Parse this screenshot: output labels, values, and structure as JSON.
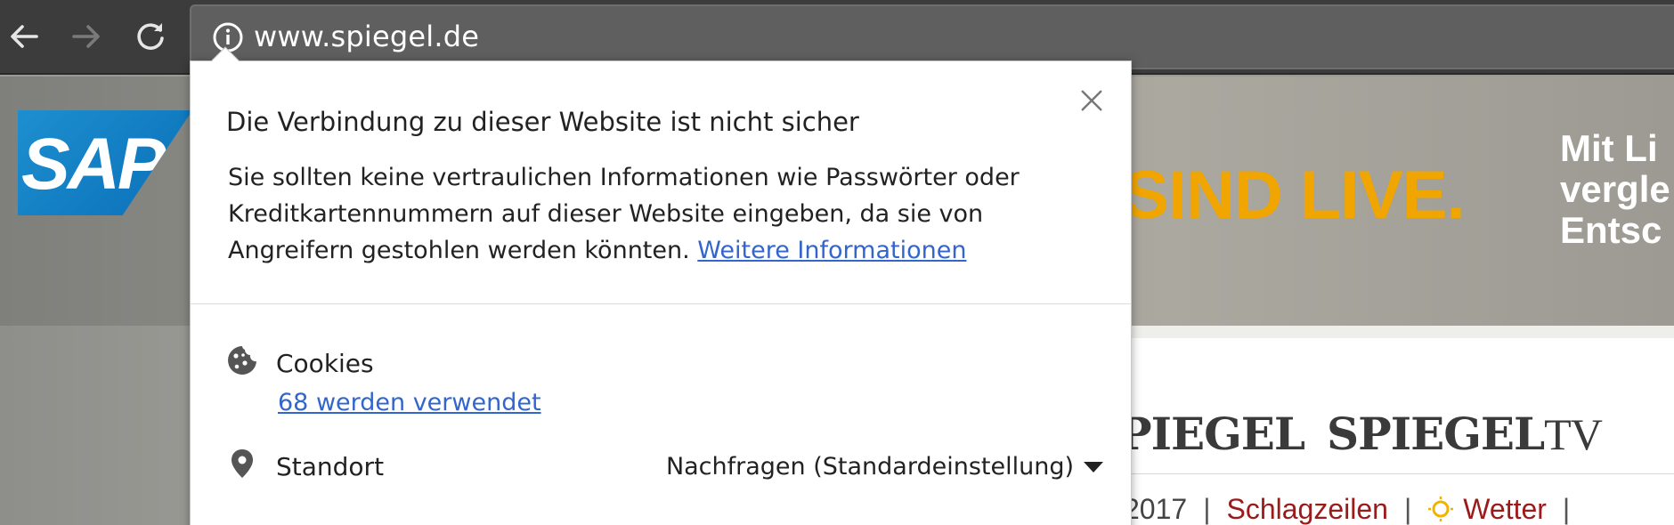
{
  "toolbar": {
    "back_icon": "arrow-left-icon",
    "forward_icon": "arrow-right-icon",
    "reload_icon": "reload-icon",
    "site_info_icon": "info-circle-icon",
    "url": "www.spiegel.de"
  },
  "background_page": {
    "ad": {
      "brand": "SAP",
      "headline": "SIND LIVE.",
      "side_text": [
        "Mit Li",
        "vergle",
        "Entsc"
      ]
    },
    "brands": [
      "PIEGEL",
      "SPIEGEL",
      "TV"
    ],
    "subnav": {
      "year": "2017",
      "separator": "|",
      "links": [
        "Schlagzeilen",
        "Wetter"
      ],
      "weather_icon": "sun-icon"
    },
    "colors": {
      "ad_headline": "#f0a500",
      "subnav_link": "#9b1b1b",
      "sap_blue": "#0a6fb7"
    }
  },
  "popup": {
    "title": "Die Verbindung zu dieser Website ist nicht sicher",
    "description": "Sie sollten keine vertraulichen Informationen wie Passwörter oder Kreditkartennummern auf dieser Website eingeben, da sie von Angreifern gestohlen werden könnten.",
    "more_info_link": "Weitere Informationen",
    "close_icon": "close-icon",
    "cookies": {
      "icon": "cookie-icon",
      "label": "Cookies",
      "link": "68 werden verwendet"
    },
    "location": {
      "icon": "location-pin-icon",
      "label": "Standort",
      "value": "Nachfragen (Standardeinstellung)"
    },
    "colors": {
      "link": "#3366cc",
      "text": "#222222"
    }
  }
}
